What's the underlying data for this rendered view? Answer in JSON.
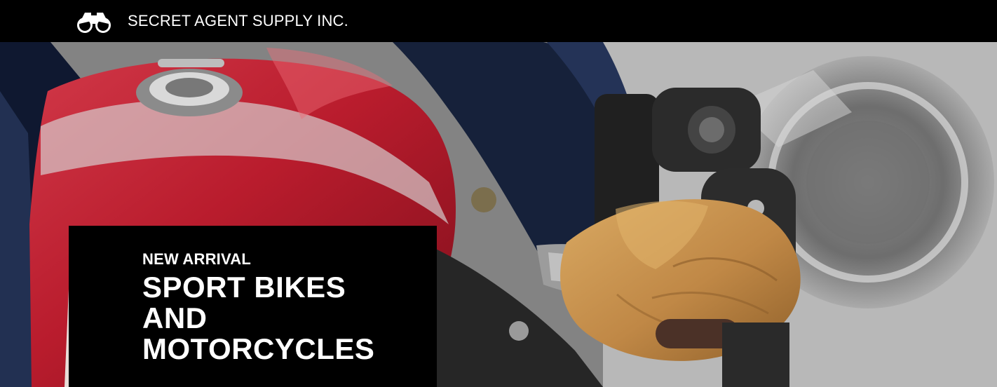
{
  "header": {
    "brand_name": "SECRET AGENT SUPPLY INC.",
    "logo_icon": "binoculars-icon"
  },
  "hero": {
    "image_subject": "motorcycle-rider-gloved-hand-photo",
    "kicker": "NEW ARRIVAL",
    "title_lines": [
      "SPORT BIKES",
      "AND",
      "MOTORCYCLES"
    ]
  },
  "colors": {
    "topbar_bg": "#000000",
    "card_bg": "#000000",
    "text": "#ffffff",
    "tank_red": "#b81f2d",
    "glove_tan": "#c7954d",
    "suit_navy": "#17223a"
  }
}
